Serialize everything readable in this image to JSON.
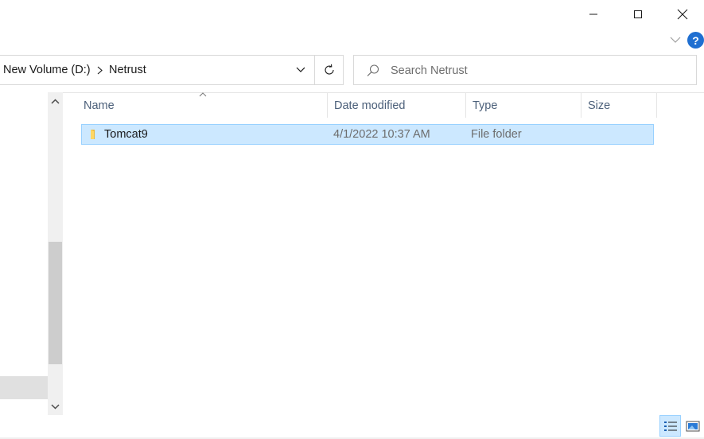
{
  "window": {
    "minimize_icon": "minimize-icon",
    "maximize_icon": "maximize-icon",
    "close_icon": "close-icon"
  },
  "ribbon": {
    "expand_icon": "chevron-down-icon",
    "help_label": "?"
  },
  "address": {
    "crumbs": [
      "New Volume (D:)",
      "Netrust"
    ],
    "separator_icon": "chevron-right-icon",
    "dropdown_icon": "chevron-down-icon",
    "refresh_icon": "refresh-icon"
  },
  "search": {
    "placeholder": "Search Netrust",
    "value": ""
  },
  "columns": {
    "name": "Name",
    "date": "Date modified",
    "type": "Type",
    "size": "Size"
  },
  "files": [
    {
      "name": "Tomcat9",
      "date": "4/1/2022 10:37 AM",
      "type": "File folder",
      "size": ""
    }
  ],
  "colors": {
    "accent": "#0078d7",
    "selection_bg": "#cce8ff",
    "selection_border": "#99d1ff",
    "help_blue": "#1f6fd1"
  }
}
